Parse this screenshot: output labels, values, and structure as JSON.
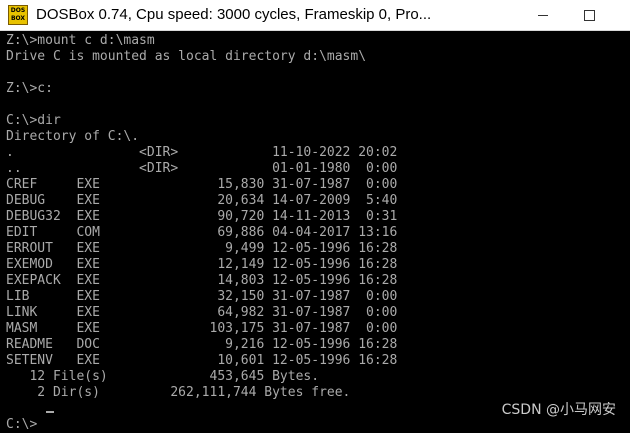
{
  "window": {
    "icon_text": "DOS\nBOX",
    "title": "DOSBox 0.74, Cpu speed:     3000 cycles, Frameskip  0, Pro..."
  },
  "console": {
    "lines": [
      "Z:\\>mount c d:\\masm",
      "Drive C is mounted as local directory d:\\masm\\",
      "",
      "Z:\\>c:",
      "",
      "C:\\>dir",
      "Directory of C:\\.",
      ".                <DIR>            11-10-2022 20:02",
      "..               <DIR>            01-01-1980  0:00",
      "CREF     EXE               15,830 31-07-1987  0:00",
      "DEBUG    EXE               20,634 14-07-2009  5:40",
      "DEBUG32  EXE               90,720 14-11-2013  0:31",
      "EDIT     COM               69,886 04-04-2017 13:16",
      "ERROUT   EXE                9,499 12-05-1996 16:28",
      "EXEMOD   EXE               12,149 12-05-1996 16:28",
      "EXEPACK  EXE               14,803 12-05-1996 16:28",
      "LIB      EXE               32,150 31-07-1987  0:00",
      "LINK     EXE               64,982 31-07-1987  0:00",
      "MASM     EXE              103,175 31-07-1987  0:00",
      "README   DOC                9,216 12-05-1996 16:28",
      "SETENV   EXE               10,601 12-05-1996 16:28",
      "   12 File(s)             453,645 Bytes.",
      "    2 Dir(s)         262,111,744 Bytes free.",
      "",
      "C:\\>"
    ]
  },
  "watermark": "CSDN @小马网安"
}
